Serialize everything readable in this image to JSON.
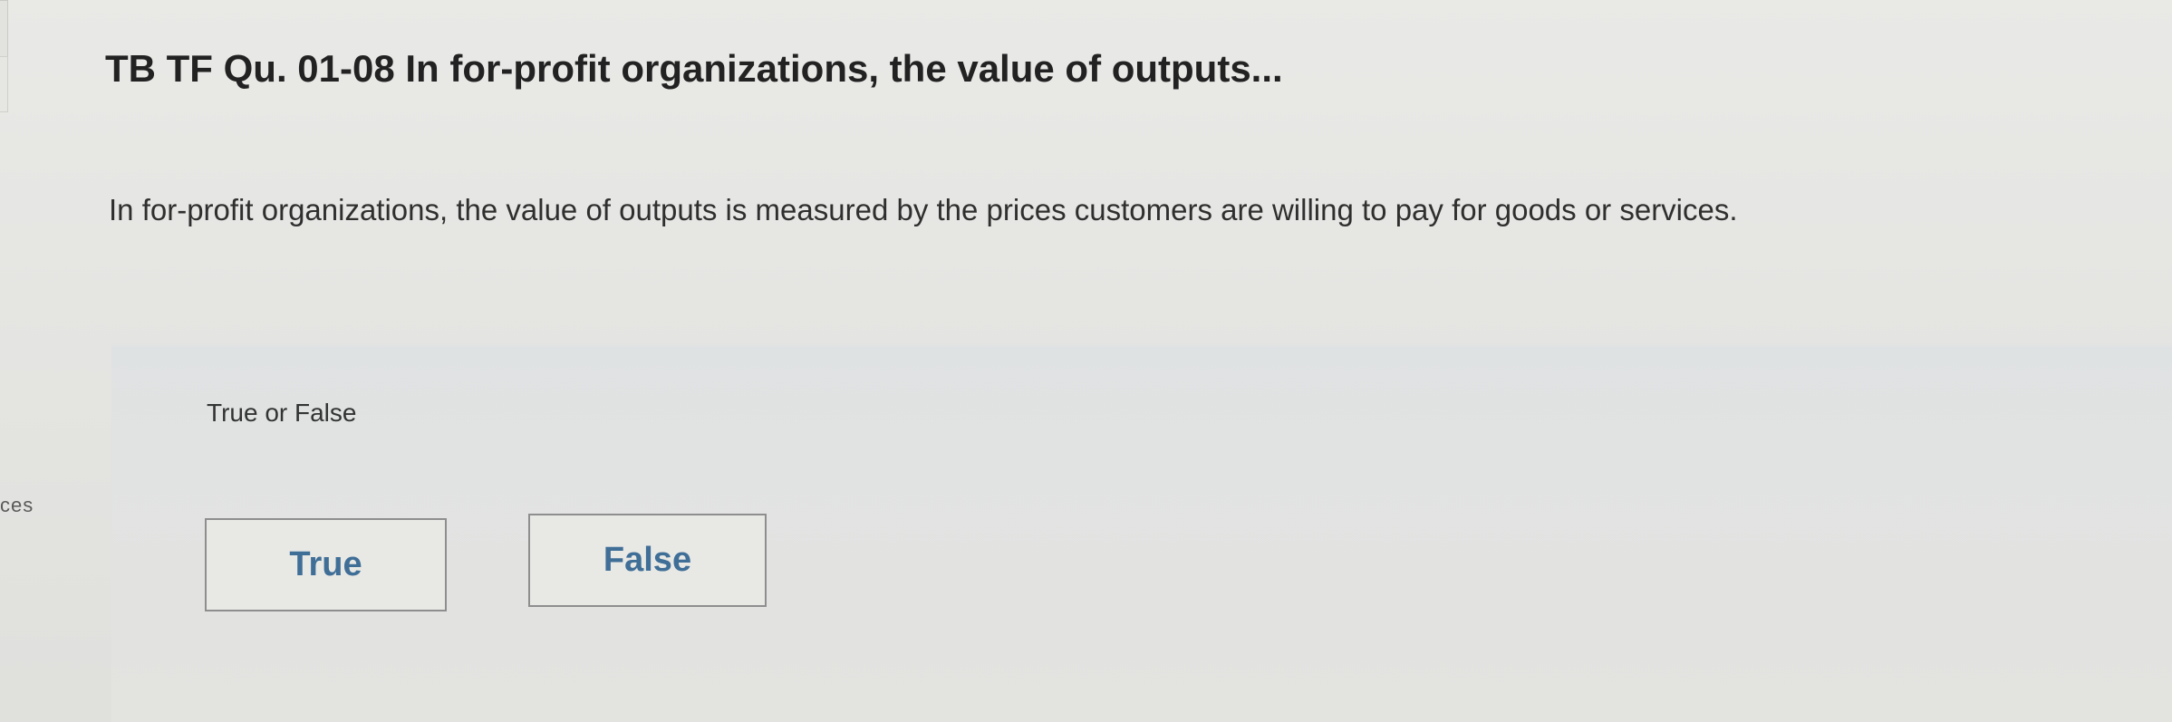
{
  "question": {
    "title": "TB TF Qu. 01-08 In for-profit organizations, the value of outputs...",
    "statement": "In for-profit organizations, the value of outputs is measured by the prices customers are willing to pay for goods or services."
  },
  "answer": {
    "prompt": "True or False",
    "options": [
      "True",
      "False"
    ]
  },
  "sidebar": {
    "partial_text": "ces"
  },
  "colors": {
    "background": "#e4e4e1",
    "option_text": "#3f6e97",
    "option_border": "#8e8e8e"
  }
}
